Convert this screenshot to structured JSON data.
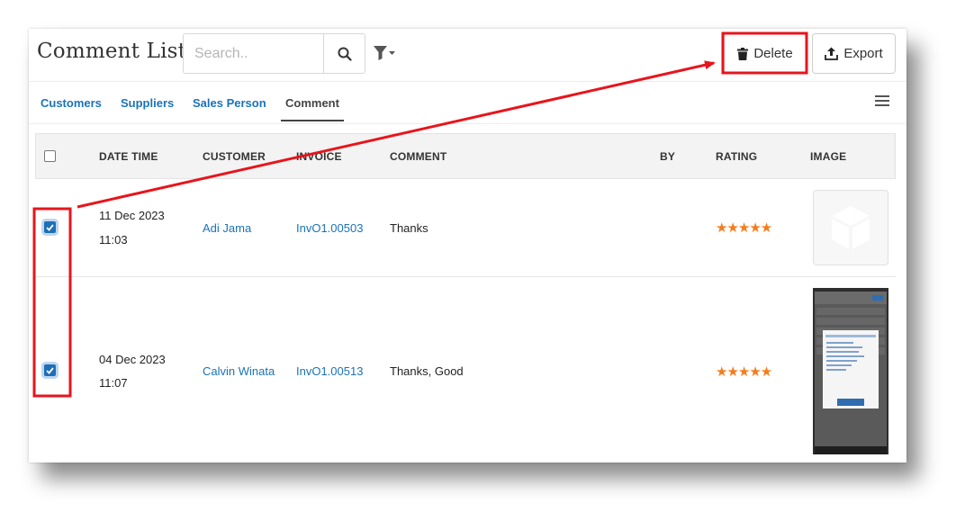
{
  "header": {
    "title": "Comment List",
    "search_placeholder": "Search..",
    "delete_label": "Delete",
    "export_label": "Export"
  },
  "tabs": [
    {
      "label": "Customers",
      "active": false
    },
    {
      "label": "Suppliers",
      "active": false
    },
    {
      "label": "Sales Person",
      "active": false
    },
    {
      "label": "Comment",
      "active": true
    }
  ],
  "table": {
    "columns": [
      "DATE TIME",
      "CUSTOMER",
      "INVOICE",
      "COMMENT",
      "BY",
      "RATING",
      "IMAGE"
    ],
    "rows": [
      {
        "date": "11 Dec 2023",
        "time": "11:03",
        "customer": "Adi Jama",
        "invoice": "InvO1.00503",
        "comment": "Thanks",
        "by": "",
        "rating": 5,
        "stars": "★★★★★",
        "checked": true,
        "image": "placeholder-image-icon"
      },
      {
        "date": "04 Dec 2023",
        "time": "11:07",
        "customer": "Calvin Winata",
        "invoice": "InvO1.00513",
        "comment": "Thanks, Good",
        "by": "",
        "rating": 5,
        "stars": "★★★★★",
        "checked": true,
        "image": "phone-screenshot"
      }
    ]
  },
  "colors": {
    "link": "#1a73b8",
    "star": "#f77b1b",
    "annotation": "#e8141c",
    "checkbox": "#1f6fb5"
  }
}
